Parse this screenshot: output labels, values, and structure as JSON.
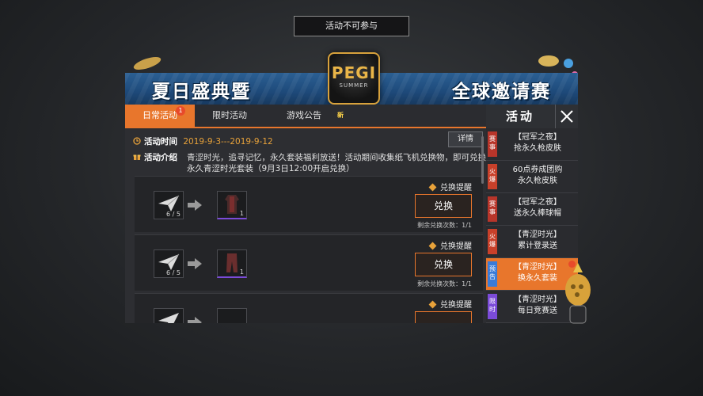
{
  "toast": "活动不可参与",
  "banner": {
    "left_text": "夏日盛典暨",
    "right_text": "全球邀请赛",
    "logo_text": "PEGI",
    "logo_sub": "SUMMER"
  },
  "tabs": [
    {
      "label": "日常活动",
      "badge": "1",
      "active": true
    },
    {
      "label": "限时活动",
      "active": false
    },
    {
      "label": "游戏公告",
      "tag": "新",
      "active": false
    }
  ],
  "header_title": "活动",
  "activity": {
    "time_label": "活动时间",
    "time_value": "2019-9-3---2019-9-12",
    "details_button": "详情",
    "intro_label": "活动介绍",
    "intro_text": "青涩时光，追寻记忆，永久套装福利放送！活动期间收集纸飞机兑换物，即可兑换永久青涩时光套装（9月3日12:00开启兑换）"
  },
  "exchange_items": [
    {
      "source_count": "6 / 5",
      "result_count": "1",
      "remind": "兑换提醒",
      "button": "兑换",
      "remaining": "剩余兑换次数：1/1"
    },
    {
      "source_count": "6 / 5",
      "result_count": "1",
      "remind": "兑换提醒",
      "button": "兑换",
      "remaining": "剩余兑换次数：1/1"
    },
    {
      "source_count": "",
      "result_count": "",
      "remind": "兑换提醒",
      "button": "",
      "remaining": ""
    }
  ],
  "sidebar": [
    {
      "tag": "赛事",
      "line1": "【冠军之夜】",
      "line2": "抢永久枪皮肤",
      "tag_color": "#b8352a"
    },
    {
      "tag": "火爆",
      "line1": "60点券成团购",
      "line2": "永久枪皮肤",
      "tag_color": "#c8402a"
    },
    {
      "tag": "赛事",
      "line1": "【冠军之夜】",
      "line2": "送永久棒球帽",
      "tag_color": "#b8352a"
    },
    {
      "tag": "火爆",
      "line1": "【青涩时光】",
      "line2": "累计登录送",
      "tag_color": "#c8402a"
    },
    {
      "tag": "预告",
      "line1": "【青涩时光】",
      "line2": "换永久套装",
      "tag_color": "#3a7bd8",
      "active": true
    },
    {
      "tag": "限时",
      "line1": "【青涩时光】",
      "line2": "每日竞赛送",
      "tag_color": "#7b4bd8"
    }
  ],
  "colors": {
    "accent": "#e8762c",
    "gold": "#e8a23a",
    "banner_blue": "#1e4a7a"
  },
  "icons": {
    "clock": "clock-icon",
    "gift": "gift-icon",
    "close": "close-icon",
    "plane": "paper-plane-icon",
    "outfit": "outfit-icon"
  }
}
